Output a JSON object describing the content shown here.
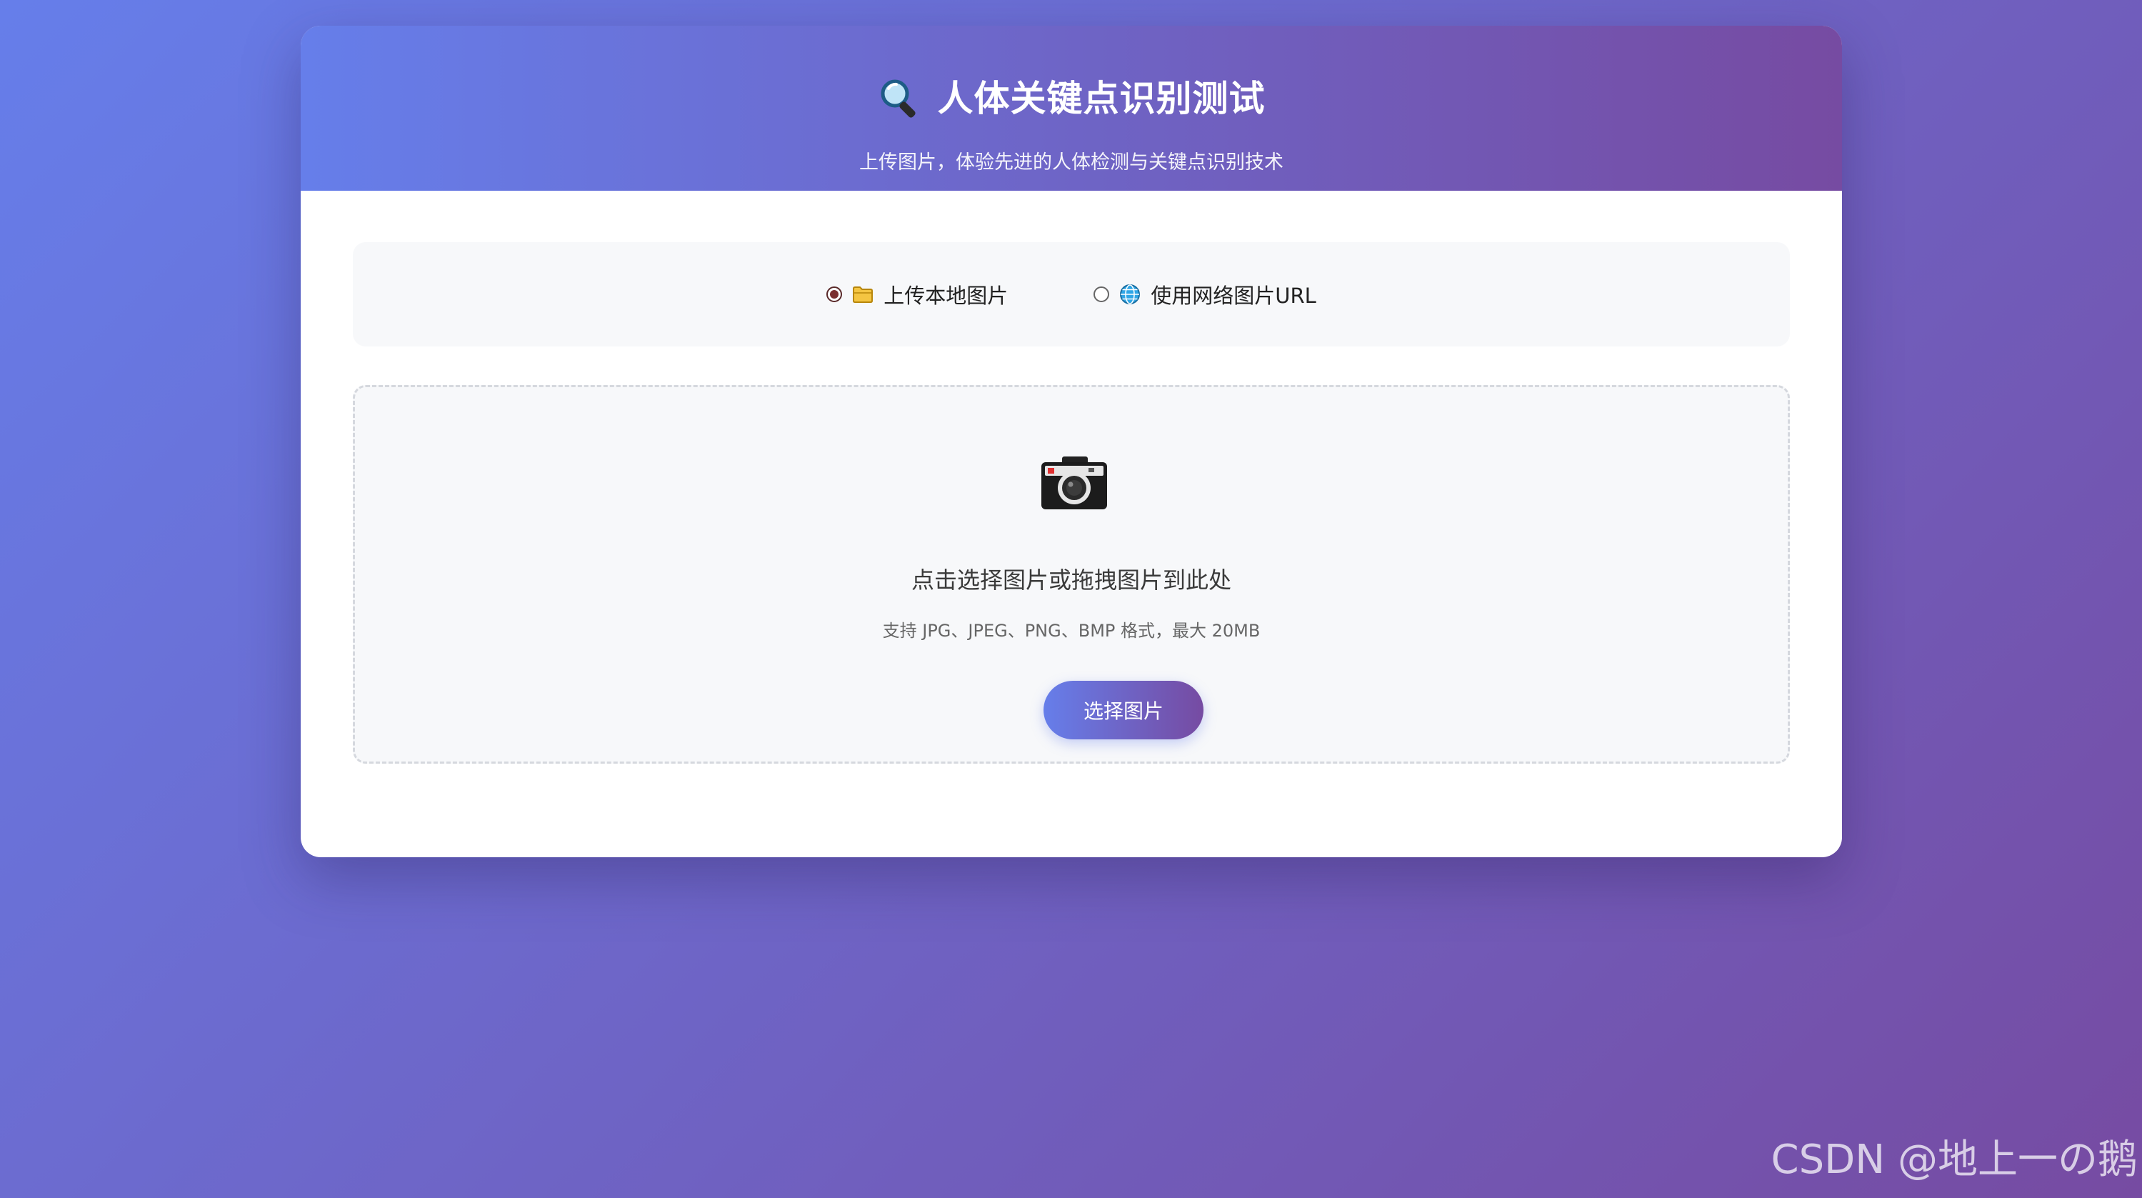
{
  "header": {
    "title": "人体关键点识别测试",
    "subtitle": "上传图片，体验先进的人体检测与关键点识别技术",
    "title_icon": "magnifier-icon"
  },
  "upload_mode": {
    "options": [
      {
        "label": "上传本地图片",
        "icon": "folder-icon",
        "selected": true
      },
      {
        "label": "使用网络图片URL",
        "icon": "globe-icon",
        "selected": false
      }
    ]
  },
  "dropzone": {
    "icon": "camera-icon",
    "prompt": "点击选择图片或拖拽图片到此处",
    "hint": "支持 JPG、JPEG、PNG、BMP 格式，最大 20MB",
    "button_label": "选择图片"
  },
  "watermark": "CSDN @地上一の鹅",
  "colors": {
    "gradient_start": "#667eea",
    "gradient_end": "#764ba2",
    "card": "#ffffff",
    "panel": "#f7f8fa"
  }
}
